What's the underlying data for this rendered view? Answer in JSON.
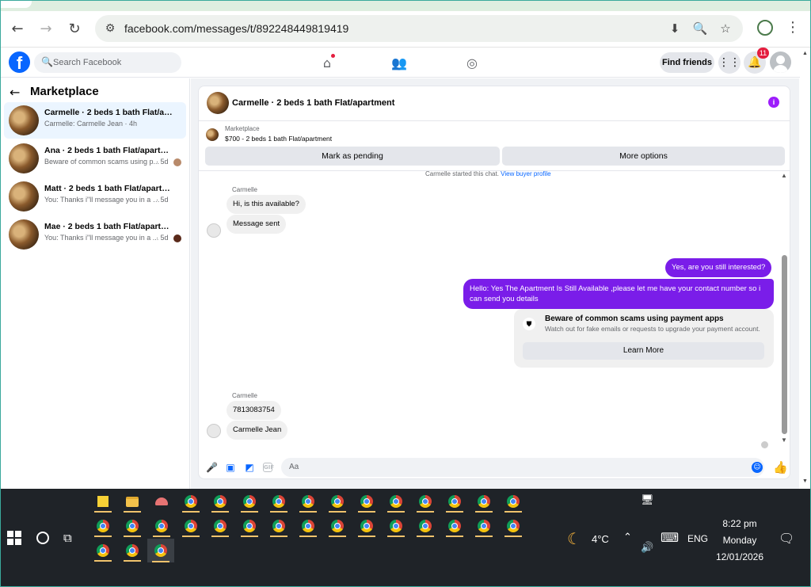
{
  "browser": {
    "url": "facebook.com/messages/t/892248449819419",
    "back_icon": "←",
    "forward_icon": "→",
    "reload_icon": "↻",
    "site_info_icon": "⚙",
    "install_icon": "⬇",
    "zoom_icon": "🔍",
    "bookmark_icon": "☆",
    "menu_icon": "⋮"
  },
  "fb": {
    "logo": "f",
    "search_placeholder": "Search Facebook",
    "search_icon": "🔍",
    "nav": {
      "home_icon": "⌂",
      "friends_icon": "👥",
      "groups_icon": "◎"
    },
    "find_friends": "Find friends",
    "menu_icon": "⋮⋮",
    "bell_icon": "🔔",
    "notif_count": "11"
  },
  "left": {
    "back_icon": "←",
    "title": "Marketplace",
    "conversations": [
      {
        "title": "Carmelle · 2 beds 1 bath Flat/apartment",
        "preview": "Carmelle: Carmelle Jean · 4h",
        "time": ""
      },
      {
        "title": "Ana · 2 beds 1 bath Flat/apartment",
        "preview": "Beware of common scams using p...",
        "time": "· 5d"
      },
      {
        "title": "Matt · 2 beds 1 bath Flat/apartment",
        "preview": "You: Thanks i\"ll message you in a mo...",
        "time": "· 5d"
      },
      {
        "title": "Mae · 2 beds 1 bath Flat/apartment",
        "preview": "You: Thanks i\"ll message you in a ...",
        "time": "· 5d"
      }
    ]
  },
  "chat": {
    "header_title": "Carmelle · 2 beds 1 bath Flat/apartment",
    "info_icon": "i",
    "marketplace_label": "Marketplace",
    "listing": "$700 - 2 beds 1 bath Flat/apartment",
    "mark_pending": "Mark as pending",
    "more_options": "More options",
    "started_text": "Carmelle started this chat.",
    "started_link": "View buyer profile",
    "sender1": "Carmelle",
    "msg_in_1": "Hi, is this available?",
    "msg_in_2": "Message sent",
    "msg_out_1": "Yes, are you still interested?",
    "msg_out_2": "Hello: Yes The Apartment Is Still Available ,please let me have your contact number so i can send you details",
    "warn_icon": "⛊",
    "warn_title": "Beware of common scams using payment apps",
    "warn_sub": "Watch out for fake emails or requests to upgrade your payment account.",
    "learn_more": "Learn More",
    "sender2": "Carmelle",
    "msg_in_3": "7813083754",
    "msg_in_4": "Carmelle Jean",
    "composer_placeholder": "Aa",
    "mic_icon": "🎤",
    "photo_icon": "▣",
    "sticker_icon": "◩",
    "gif_label": "GIF",
    "emoji_icon": "☺",
    "like_icon": "👍",
    "scroll_up": "▲",
    "scroll_down": "▼"
  },
  "taskbar": {
    "taskview_icon": "⧉",
    "weather_icon": "☾",
    "temperature": "4°C",
    "tray_up": "⌃",
    "keyboard_icon": "⌨",
    "volume_icon": "🔊",
    "network_icon": "🖥",
    "language": "ENG",
    "time": "8:22 pm",
    "day": "Monday",
    "date": "12/01/2026",
    "notification_icon": "🗨"
  }
}
